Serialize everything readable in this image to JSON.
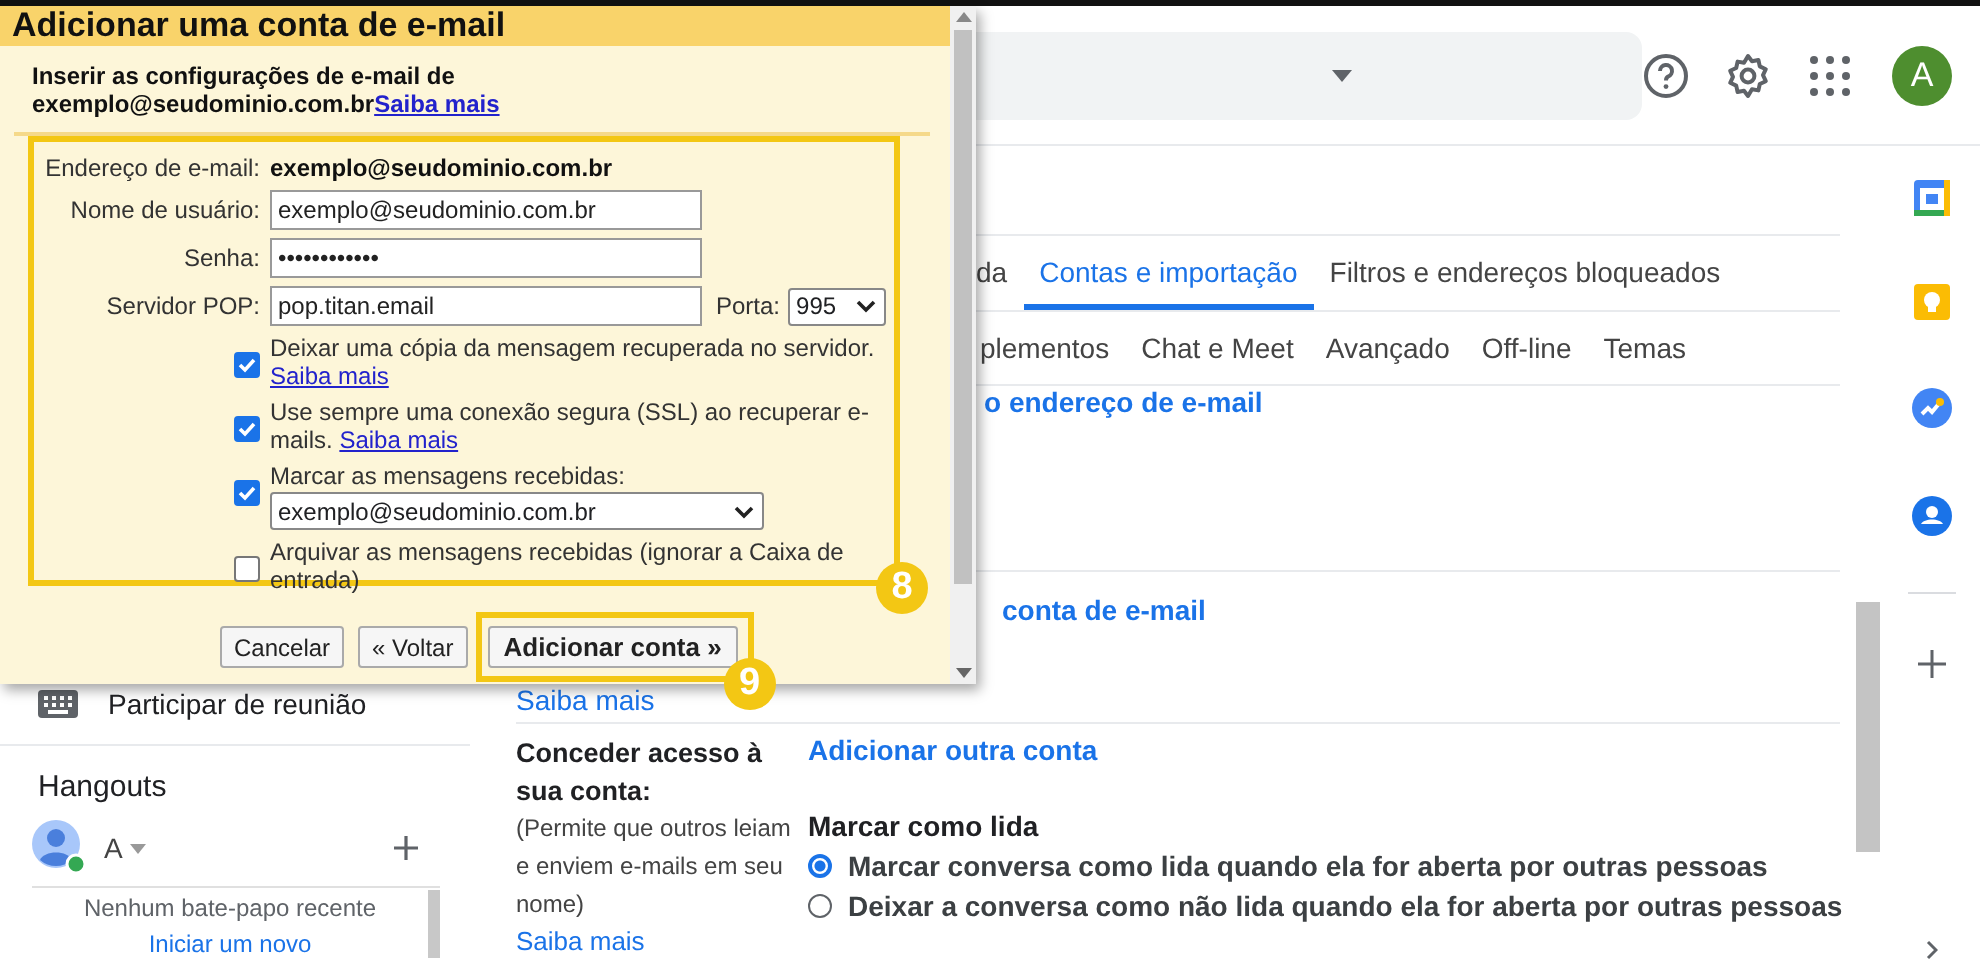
{
  "header": {
    "avatar_letter": "A"
  },
  "settings_tabs": [
    {
      "label": "da",
      "selected": false
    },
    {
      "label": "Contas e importação",
      "selected": true
    },
    {
      "label": "Filtros e endereços bloqueados",
      "selected": false
    }
  ],
  "settings_tabs_row2": [
    {
      "label": "plementos",
      "selected": false
    },
    {
      "label": "Chat e Meet",
      "selected": false
    },
    {
      "label": "Avançado",
      "selected": false
    },
    {
      "label": "Off-line",
      "selected": false
    },
    {
      "label": "Temas",
      "selected": false
    }
  ],
  "sections": [
    {
      "link": "o endereço de e-mail"
    },
    {
      "link": "conta de e-mail",
      "help_link": "Saiba mais"
    },
    {
      "label": "Conceder acesso à sua conta:",
      "description": "(Permite que outros leiam e enviem e-mails em seu nome)",
      "help_link": "Saiba mais",
      "link": "Adicionar outra conta",
      "option_title": "Marcar como lida",
      "radios": [
        {
          "label": "Marcar conversa como lida quando ela for aberta por outras pessoas",
          "selected": true
        },
        {
          "label": "Deixar a conversa como não lida quando ela for aberta por outras pessoas",
          "selected": false
        }
      ]
    }
  ],
  "sidebar": {
    "join_meeting": "Participar de reunião",
    "hangouts_title": "Hangouts",
    "hangouts_user": "A",
    "empty_chats": "Nenhum bate-papo recente",
    "start_chat": "Iniciar um novo"
  },
  "dialog": {
    "title": "Adicionar uma conta de e-mail",
    "intro": "Inserir as configurações de e-mail de exemplo@seudominio.com.br",
    "intro_link": "Saiba mais",
    "fields": [
      {
        "kind": "static",
        "label": "Endereço de e-mail:",
        "value": "exemplo@seudominio.com.br"
      },
      {
        "kind": "input",
        "label": "Nome de usuário:",
        "value": "exemplo@seudominio.com.br"
      },
      {
        "kind": "input",
        "label": "Senha:",
        "value": "••••••••••••"
      },
      {
        "kind": "input_port",
        "label": "Servidor POP:",
        "value": "pop.titan.email",
        "port_label": "Porta:",
        "port_value": "995"
      }
    ],
    "options": [
      {
        "kind": "check",
        "text": "Deixar uma cópia da mensagem recuperada no servidor.",
        "link": "Saiba mais",
        "checked": true
      },
      {
        "kind": "check",
        "text": "Use sempre uma conexão segura (SSL) ao recuperar e-mails.",
        "link": "Saiba mais",
        "checked": true
      },
      {
        "kind": "check_select",
        "text": "Marcar as mensagens recebidas:",
        "select_value": "exemplo@seudominio.com.br",
        "checked": true
      },
      {
        "kind": "check",
        "text": "Arquivar as mensagens recebidas (ignorar a Caixa de entrada)",
        "checked": false
      }
    ],
    "buttons": [
      {
        "label": "Cancelar",
        "kind": "plain"
      },
      {
        "label": "« Voltar",
        "kind": "plain"
      },
      {
        "label": "Adicionar conta »",
        "kind": "primary"
      }
    ]
  },
  "annotations": [
    {
      "number": "8"
    },
    {
      "number": "9"
    }
  ]
}
